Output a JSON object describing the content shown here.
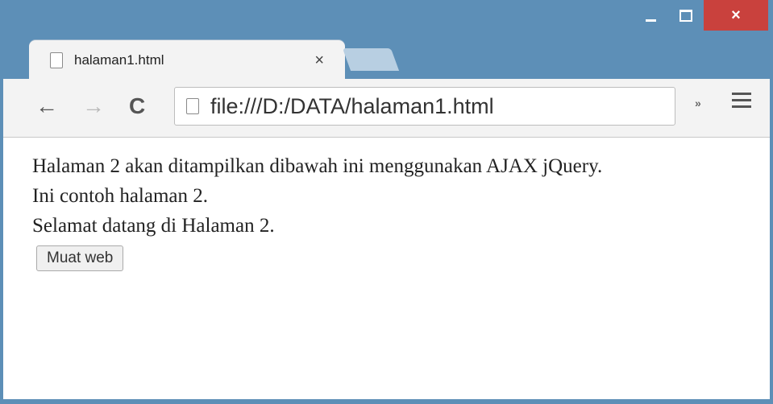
{
  "window": {
    "controls": {
      "minimize": "",
      "maximize": "",
      "close": "×"
    }
  },
  "tab": {
    "title": "halaman1.html",
    "close": "×"
  },
  "toolbar": {
    "back": "←",
    "forward": "→",
    "reload": "C",
    "url": "file:///D:/DATA/halaman1.html",
    "extensions": "»"
  },
  "content": {
    "line1": "Halaman 2 akan ditampilkan dibawah ini menggunakan AJAX jQuery.",
    "line2": "Ini contoh halaman 2.",
    "line3": "Selamat datang di Halaman 2.",
    "button_label": "Muat web"
  }
}
